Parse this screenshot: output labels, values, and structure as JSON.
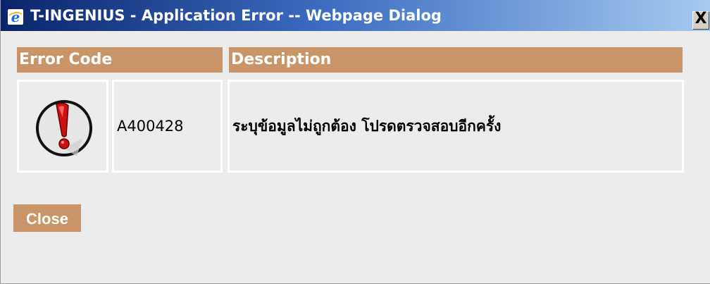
{
  "window": {
    "title": "T-INGENIUS - Application Error -- Webpage Dialog",
    "close_symbol": "X"
  },
  "table": {
    "headers": [
      "Error Code",
      "Description"
    ],
    "rows": [
      {
        "icon": "error-exclamation-icon",
        "code": "A400428",
        "description": "ระบุข้อมูลไม่ถูกต้อง โปรดตรวจสอบอีกครั้ง"
      }
    ]
  },
  "buttons": {
    "close_label": "Close"
  },
  "icons": {
    "title": "ie-icon",
    "close": "close-icon"
  },
  "colors": {
    "title_gradient_start": "#0a246a",
    "title_gradient_end": "#a6caf0",
    "header_bg": "#c89468",
    "dialog_bg": "#ececec",
    "icon_red": "#cc1111"
  }
}
